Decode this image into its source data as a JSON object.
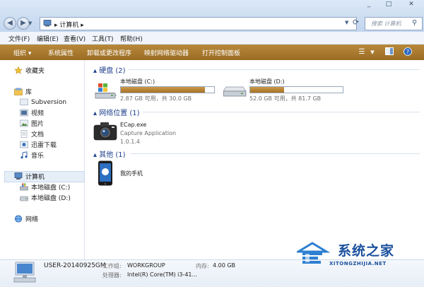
{
  "window": {
    "minimize": "_",
    "maximize": "□",
    "close": "✕"
  },
  "address": {
    "path": "计算机",
    "separator": "▸"
  },
  "search": {
    "placeholder": "搜索 计算机"
  },
  "menu": [
    {
      "label": "文件(F)"
    },
    {
      "label": "编辑(E)"
    },
    {
      "label": "查看(V)"
    },
    {
      "label": "工具(T)"
    },
    {
      "label": "帮助(H)"
    }
  ],
  "commands": [
    {
      "label": "组织 ▾"
    },
    {
      "label": "系统属性"
    },
    {
      "label": "卸载或更改程序"
    },
    {
      "label": "映射网络驱动器"
    },
    {
      "label": "打开控制面板"
    }
  ],
  "sidebar": {
    "favorites": "收藏夹",
    "libraries": "库",
    "library_items": [
      "Subversion",
      "视频",
      "图片",
      "文档",
      "迅雷下载",
      "音乐"
    ],
    "computer": "计算机",
    "computer_items": [
      "本地磁盘 (C:)",
      "本地磁盘 (D:)"
    ],
    "network": "网络"
  },
  "groups": {
    "drives": "硬盘 (2)",
    "network": "网络位置 (1)",
    "other": "其他 (1)"
  },
  "drives": [
    {
      "name": "本地磁盘 (C:)",
      "info": "2.87 GB 可用，共 30.0 GB",
      "used_fraction": 0.904
    },
    {
      "name": "本地磁盘 (D:)",
      "info": "52.0 GB 可用，共 81.7 GB",
      "used_fraction": 0.364
    }
  ],
  "network_item": {
    "name": "ECap.exe",
    "description": "Capture Application",
    "version": "1.0.1.4"
  },
  "other_item": {
    "name": "我的手机"
  },
  "details": {
    "computer_name": "USER-20140925GM",
    "workgroup_label": "工作组:",
    "workgroup": "WORKGROUP",
    "memory_label": "内存:",
    "memory": "4.00 GB",
    "cpu_label": "处理器:",
    "cpu": "Intel(R) Core(TM) i3-41..."
  },
  "watermark": {
    "title": "系统之家",
    "url": "XITONGZHIJIA.NET"
  },
  "colors": {
    "command_bar": "#a8782c",
    "drive_fill": "#b8832f",
    "group_text": "#1e3f8c"
  }
}
